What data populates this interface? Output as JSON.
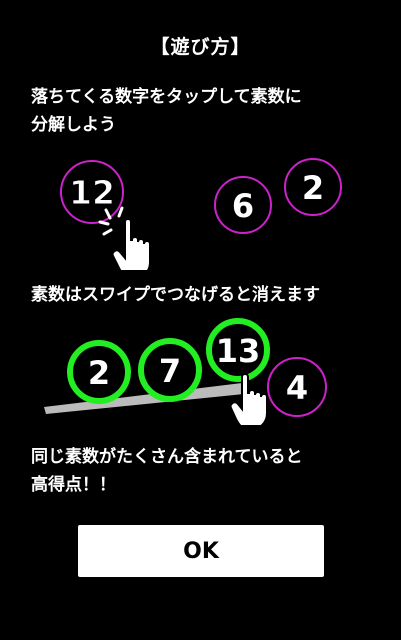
{
  "dialog": {
    "title": "【遊び方】",
    "step1": "落ちてくる数字をタップして素数に\n分解しよう",
    "step2": "素数はスワイプでつなげると消えます",
    "step3": "同じ素数がたくさん含まれていると\n高得点！！",
    "ok_label": "OK"
  },
  "illustration1": {
    "composite": "12",
    "split_numbers": [
      "6",
      "2"
    ],
    "icon": "tapping-hand-icon"
  },
  "illustration2": {
    "connected_primes": [
      "2",
      "7",
      "13"
    ],
    "other_number": "4",
    "icon": "swiping-hand-icon"
  },
  "colors": {
    "background": "#000000",
    "text": "#ffffff",
    "circle_magenta": "#cc22cc",
    "circle_selected_green": "#22ee22",
    "swipe_trail": "#bbbbbb",
    "button_bg": "#ffffff"
  }
}
